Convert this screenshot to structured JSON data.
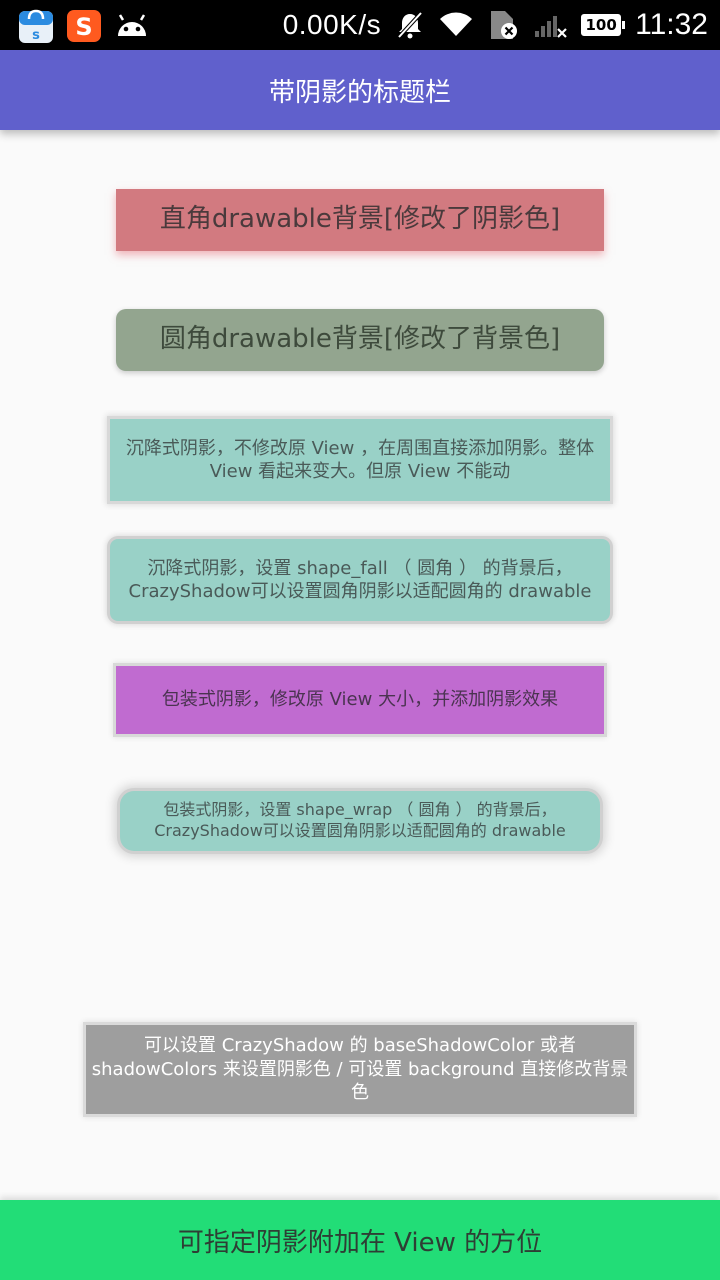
{
  "status_bar": {
    "net_speed": "0.00K/s",
    "battery": "100",
    "time": "11:32",
    "icons": [
      "app-store-icon",
      "sogou-input-icon",
      "android-icon",
      "mute-icon",
      "wifi-icon",
      "sim-no-service-icon",
      "signal-icon",
      "battery-icon"
    ]
  },
  "title_bar": {
    "title": "带阴影的标题栏",
    "color": "#6060cc"
  },
  "cards": {
    "c1": "直角drawable背景[修改了阴影色]",
    "c2": "圆角drawable背景[修改了背景色]",
    "c3": "沉降式阴影，不修改原 View ，在周围直接添加阴影。整体 View 看起来变大。但原 View 不能动",
    "c4": "沉降式阴影，设置 shape_fall （ 圆角 ） 的背景后，CrazyShadow可以设置圆角阴影以适配圆角的 drawable",
    "c5": "包装式阴影，修改原 View 大小，并添加阴影效果",
    "c6": "包装式阴影，设置 shape_wrap （ 圆角 ） 的背景后，CrazyShadow可以设置圆角阴影以适配圆角的 drawable",
    "c7": "可以设置 CrazyShadow 的 baseShadowColor 或者 shadowColors 来设置阴影色 / 可设置 background 直接修改背景色"
  },
  "bottom_button": {
    "label": "可指定阴影附加在 View 的方位",
    "color": "#22dd77"
  }
}
